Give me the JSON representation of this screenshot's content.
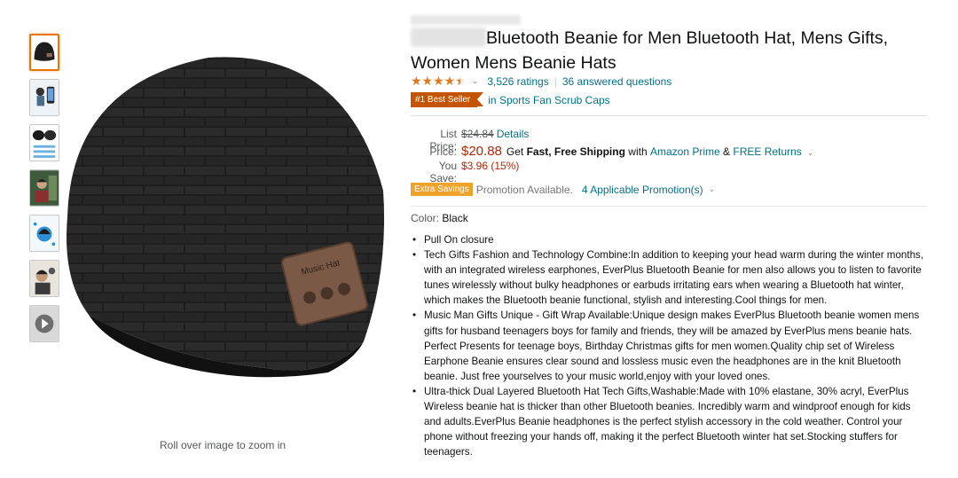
{
  "gallery": {
    "thumbnails": [
      {
        "name": "beanie"
      },
      {
        "name": "person-wearing"
      },
      {
        "name": "beanies-set"
      },
      {
        "name": "lifestyle"
      },
      {
        "name": "diagram"
      },
      {
        "name": "man-listening"
      },
      {
        "name": "video"
      }
    ],
    "zoom_hint": "Roll over image to zoom in"
  },
  "product": {
    "title": "Bluetooth Beanie for Men Bluetooth Hat, Mens Gifts, Women Mens Beanie Hats",
    "rating_text": "3,526 ratings",
    "answered": "36 answered questions",
    "rating_value": 4.5,
    "badge": "#1 Best Seller",
    "badge_category": "in Sports Fan Scrub Caps"
  },
  "price": {
    "list_label": "List Price:",
    "list_value": "$24.84",
    "details": "Details",
    "price_label": "Price:",
    "price_value": "$20.88",
    "get": "Get",
    "shipping": "Fast, Free Shipping",
    "with": "with",
    "prime": "Amazon Prime",
    "amp": "&",
    "returns": "FREE Returns",
    "save_label": "You Save:",
    "save_value": "$3.96 (15%)"
  },
  "promo": {
    "badge": "Extra Savings",
    "text": "Promotion Available.",
    "link": "4 Applicable Promotion(s)"
  },
  "color": {
    "label": "Color:",
    "value": "Black"
  },
  "bullets": [
    "Pull On closure",
    "Tech Gifts Fashion and Technology Combine:In addition to keeping your head warm during the winter months, with an integrated wireless earphones, EverPlus Bluetooth Beanie for men also allows you to listen to favorite tunes wirelessly without bulky headphones or earbuds irritating ears when wearing a Bluetooth hat winter, which makes the Bluetooth beanie functional, stylish and interesting.Cool things for men.",
    "Music Man Gifts Unique - Gift Wrap Available:Unique design makes EverPlus Bluetooth beanie women mens gifts for husband teenagers boys for family and friends, they will be amazed by EverPlus mens beanie hats. Perfect Presents for teenage boys, Birthday Christmas gifts for men women.Quality chip set of Wireless Earphone Beanie ensures clear sound and lossless music even the headphones are in the knit Bluetooth beanie. Just free yourselves to your music world,enjoy with your loved ones.",
    "Ultra-thick Dual Layered Bluetooth Hat Tech Gifts,Washable:Made with 10% elastane, 30% acryl, EverPlus Wireless beanie hat is thicker than other Bluetooth beanies. Incredibly warm and windproof enough for kids and adults.EverPlus Beanie headphones is the perfect stylish accessory in the cold weather. Control your phone without freezing your hands off, making it the perfect Bluetooth winter hat set.Stocking stuffers for teenagers."
  ],
  "hat_patch_text": "Music Hat",
  "colors": {
    "link": "#007185",
    "price": "#b12704",
    "star": "#de7921",
    "best_seller": "#c45500",
    "extra_savings": "#f0a32b"
  }
}
